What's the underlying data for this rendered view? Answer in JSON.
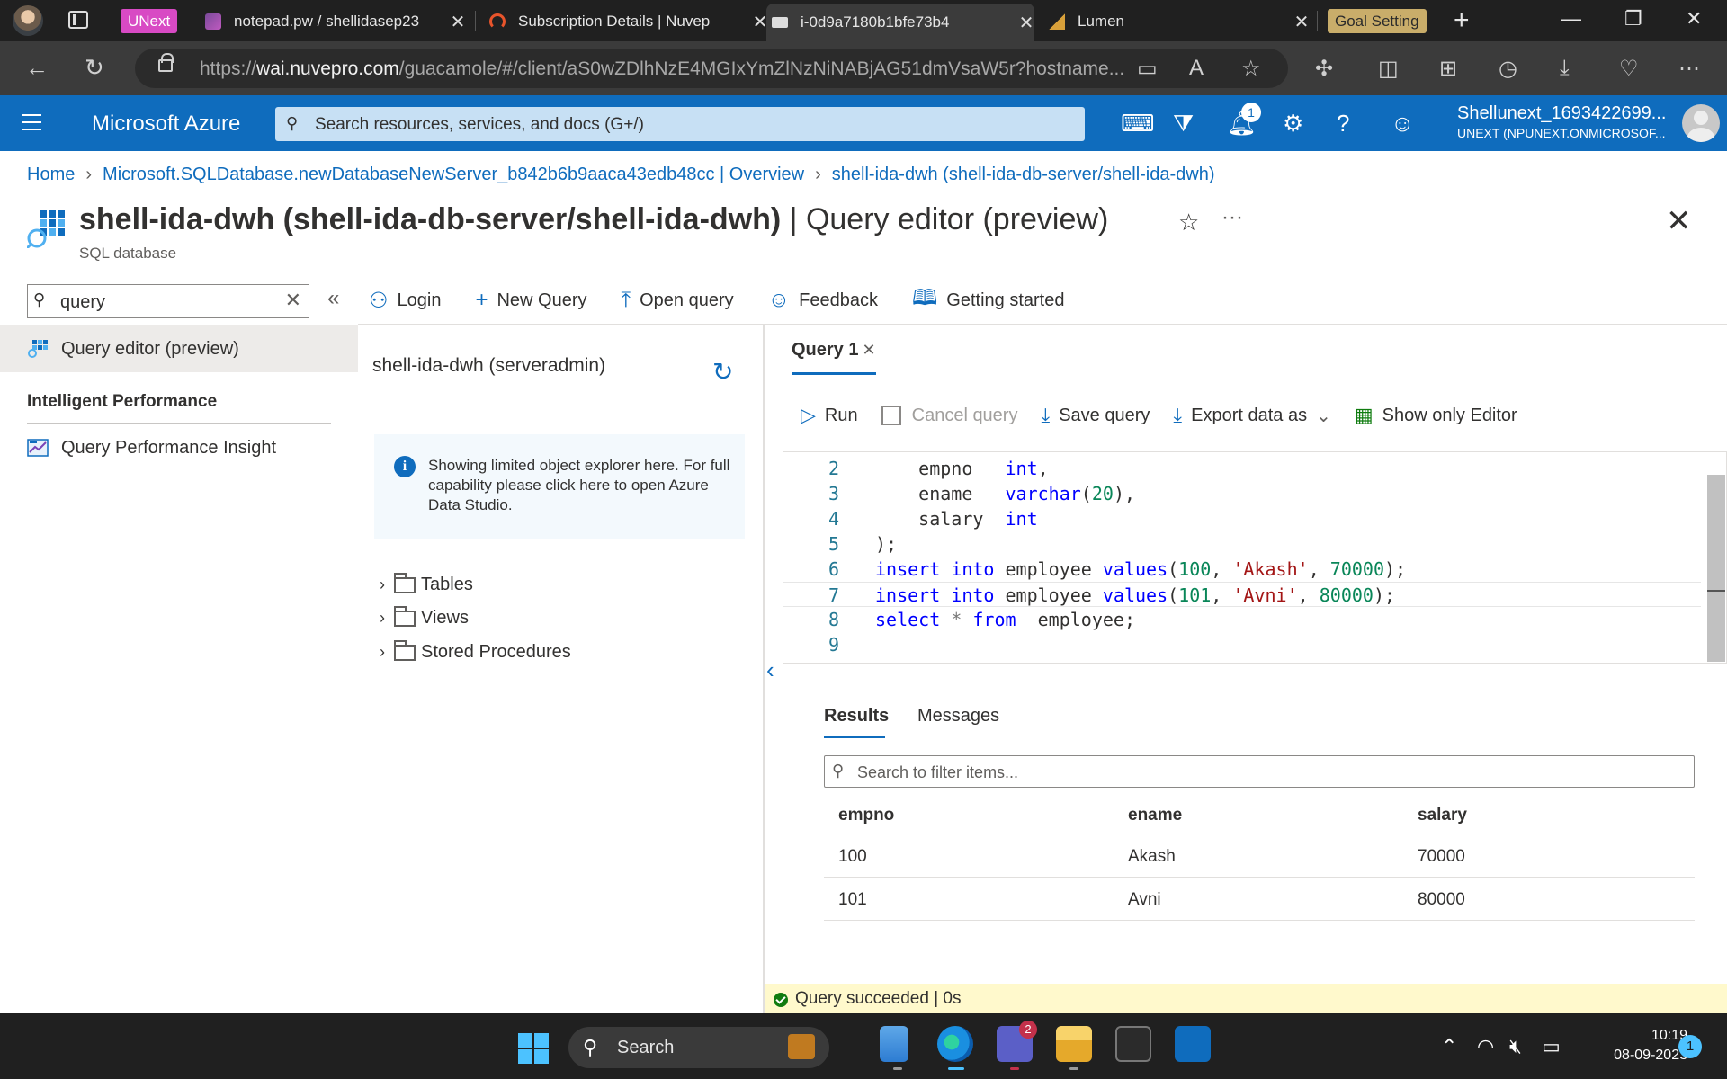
{
  "browser": {
    "tabs": [
      {
        "label": "UNext"
      },
      {
        "label": "notepad.pw / shellidasep23"
      },
      {
        "label": "Subscription Details | Nuvep"
      },
      {
        "label": "i-0d9a7180b1bfe73b4"
      },
      {
        "label": "Lumen"
      },
      {
        "label": "Goal Setting"
      }
    ],
    "url_prefix": "https://",
    "url_domain": "wai.nuvepro.com",
    "url_rest": "/guacamole/#/client/aS0wZDlhNzE4MGIxYmZlNzNiNABjAG51dmVsaW5r?hostname..."
  },
  "azure": {
    "brand": "Microsoft Azure",
    "search_placeholder": "Search resources, services, and docs (G+/)",
    "notification_count": "1",
    "account_name": "Shellunext_1693422699...",
    "account_tenant": "UNEXT (NPUNEXT.ONMICROSOF..."
  },
  "breadcrumb": {
    "home": "Home",
    "overview": "Microsoft.SQLDatabase.newDatabaseNewServer_b842b6b9aaca43edb48cc | Overview",
    "current": "shell-ida-dwh (shell-ida-db-server/shell-ida-dwh)"
  },
  "page": {
    "title_bold": "shell-ida-dwh (shell-ida-db-server/shell-ida-dwh)",
    "title_rest": " | Query editor (preview)",
    "subtitle": "SQL database"
  },
  "menu": {
    "search_value": "query",
    "items": [
      {
        "label": "Query editor (preview)"
      },
      {
        "label": "Query Performance Insight"
      }
    ],
    "group": "Intelligent Performance"
  },
  "commands": {
    "login": "Login",
    "new_query": "New Query",
    "open_query": "Open query",
    "feedback": "Feedback",
    "getting_started": "Getting started"
  },
  "explorer": {
    "title": "shell-ida-dwh (serveradmin)",
    "info": "Showing limited object explorer here. For full capability please click here to open Azure Data Studio.",
    "nodes": [
      "Tables",
      "Views",
      "Stored Procedures"
    ]
  },
  "editor": {
    "tab_label": "Query 1",
    "run": "Run",
    "cancel": "Cancel query",
    "save": "Save query",
    "export": "Export data as",
    "show_only": "Show only Editor",
    "lines": [
      {
        "n": "2",
        "text": "    empno   int,"
      },
      {
        "n": "3",
        "text": "    ename   varchar(20),"
      },
      {
        "n": "4",
        "text": "    salary  int"
      },
      {
        "n": "5",
        "text": ");"
      },
      {
        "n": "6",
        "text": "insert into employee values(100, 'Akash', 70000);"
      },
      {
        "n": "7",
        "text": "insert into employee values(101, 'Avni', 80000);"
      },
      {
        "n": "8",
        "text": "select * from  employee;"
      },
      {
        "n": "9",
        "text": ""
      }
    ]
  },
  "results": {
    "tab_results": "Results",
    "tab_messages": "Messages",
    "search_placeholder": "Search to filter items...",
    "columns": [
      "empno",
      "ename",
      "salary"
    ],
    "rows": [
      [
        "100",
        "Akash",
        "70000"
      ],
      [
        "101",
        "Avni",
        "80000"
      ]
    ]
  },
  "status": "Query succeeded | 0s",
  "taskbar": {
    "search": "Search",
    "teams_badge": "2",
    "time": "10:19",
    "date": "08-09-2023",
    "notifications": "1"
  }
}
